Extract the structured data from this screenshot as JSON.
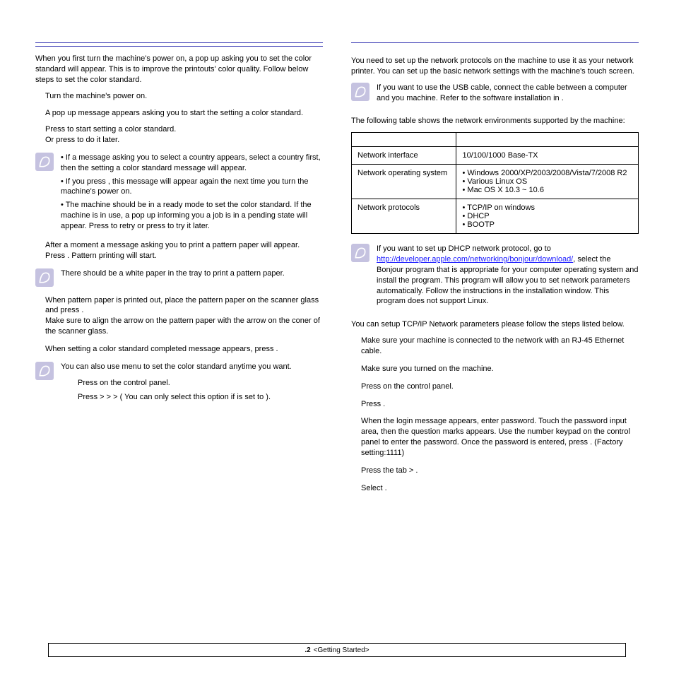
{
  "left": {
    "intro": "When you first turn the machine's power on, a pop up asking you to set the color standard will appear. This is to improve the printouts' color quality. Follow below steps to set the color standard.",
    "s1": "Turn the machine's power on.",
    "s2a": "A pop up message appears asking you to start  the setting a color standard.",
    "s2b": "Press          to start setting a color standard.",
    "s2c": "Or press             to do it later.",
    "n1a": "• If a message asking you to select a country appears, select a country first, then the setting a color standard message will appear.",
    "n1b": "• If you press            , this message will appear again the next time you turn the machine's power on.",
    "n1c": "• The machine should be in a ready mode to set the color standard. If the machine is in use, a pop up informing you a job is in a pending state will appear. Press           to retry or press              to try it later.",
    "s3a": "After a moment a message asking you to print a pattern paper will appear.",
    "s3b": "Press         . Pattern printing will start.",
    "n2": "There should be a white paper in the tray to print a pattern paper.",
    "s4a": "When pattern paper is printed out, place the pattern paper on the scanner glass and press           .",
    "s4b": "Make sure to align the arrow on the pattern paper with the arrow on the coner of the scanner glass.",
    "s5": "When setting a color standard completed message appears, press          .",
    "n3": "You can also use                                                    menu to set the color standard anytime you want.",
    "sub1": "Press                               on the control panel.",
    "sub2": "Press                            >               >               >                                               ( You can only select this option if                                                           is set to        ).",
    "sub2_tail": ""
  },
  "right": {
    "intro": "You need to set up the network protocols on the machine to use it as your network printer. You can set up the basic network settings with the machine's touch screen.",
    "n1": "If you want to use the USB cable, connect the cable between a computer and you machine. Refer to the software installation in                                      .",
    "tbl_intro": "The following table shows the network environments supported by the machine:",
    "th1": "",
    "th2": "",
    "r1c1": "Network interface",
    "r1c2": "10/100/1000 Base-TX",
    "r2c1": "Network operating system",
    "r2c2a": "Windows 2000/XP/2003/2008/Vista/7/2008 R2",
    "r2c2b": "Various Linux OS",
    "r2c2c": "Mac OS X 10.3 ~ 10.6",
    "r3c1": "Network protocols",
    "r3c2a": "TCP/IP on windows",
    "r3c2b": "DHCP",
    "r3c2c": "BOOTP",
    "n2a": "If you want to set up DHCP network protocol, go to ",
    "n2_link": "http://developer.apple.com/networking/bonjour/download/",
    "n2b": ", select the Bonjour program that is appropriate for your computer operating system and install the program. This program will allow you to set network parameters automatically. Follow the instructions in the installation window. This program does not support Linux.",
    "tcp_intro": "You can setup TCP/IP Network parameters please follow the steps listed below.",
    "t1": "Make sure your machine is connected to the network with an RJ-45 Ethernet cable.",
    "t2": "Make sure you turned on the machine.",
    "t3": "Press                               on the control panel.",
    "t4": "Press                            .",
    "t5": "When the login message appears, enter password. Touch the password input area, then the question marks appears. Use the number keypad on the control panel to enter the password. Once the password is entered, press       . (Factory setting:1111)",
    "t6": "Press the              tab >                                       .",
    "t7": "Select                              ."
  },
  "footer": {
    "page": ".2",
    "section": "<Getting Started>"
  }
}
